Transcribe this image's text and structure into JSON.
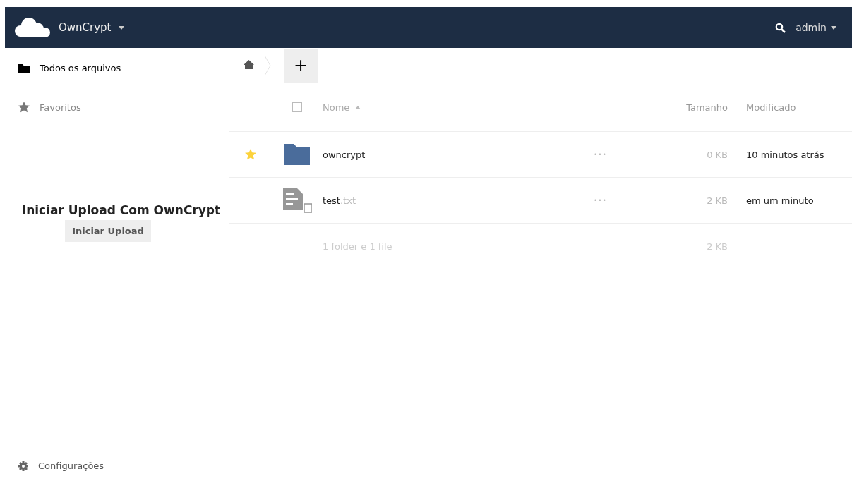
{
  "header": {
    "app_name": "OwnCrypt",
    "user": "admin"
  },
  "sidebar": {
    "items": [
      {
        "label": "Todos os arquivos",
        "kind": "folder",
        "selected": true
      },
      {
        "label": "Favoritos",
        "kind": "star",
        "selected": false
      }
    ],
    "upload_panel": {
      "title": "Iniciar Upload Com OwnCrypt",
      "button": "Iniciar Upload"
    },
    "settings": "Configurações"
  },
  "breadcrumb": {
    "new_button": "+"
  },
  "table": {
    "select_all": {
      "checked": false
    },
    "columns": [
      "Nome",
      "Tamanho",
      "Modificado"
    ],
    "rows": [
      {
        "kind": "folder",
        "name": "owncrypt",
        "favorite": true,
        "actions": "•••",
        "size": "0 KB",
        "modified": "10 minutos atrás"
      },
      {
        "kind": "file",
        "name": "test",
        "extension": ".txt",
        "favorite": false,
        "actions": "•••",
        "size": "2 KB",
        "modified": "em um minuto"
      }
    ],
    "summary": {
      "label": "1 folder e 1 file",
      "size": "2 KB"
    }
  }
}
